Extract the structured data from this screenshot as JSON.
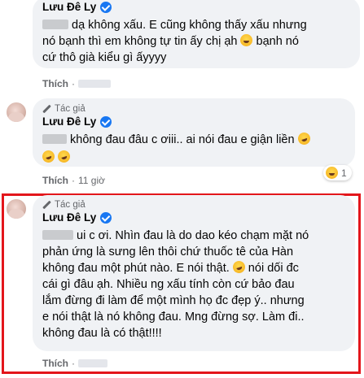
{
  "comments": [
    {
      "author": "Lưu Đê Ly",
      "lines": [
        [
          "",
          " dạ không xấu. E cũng không thấy xấu nhưng"
        ],
        [
          "nó bạnh thì em không tự tin ấy chị ạh ",
          "",
          " bạnh nó"
        ],
        [
          "cứ thô già kiểu gì ấyyyy"
        ]
      ],
      "like_label": "Thích",
      "time": ""
    },
    {
      "author": "Lưu Đê Ly",
      "author_badge": "Tác giả",
      "lines": [
        [
          "",
          " không đau đâu c ơiii.. ai nói đau e giận liền "
        ],
        [
          ""
        ]
      ],
      "like_label": "Thích",
      "time": "11 giờ",
      "reaction_count": "1"
    },
    {
      "author": "Lưu Đê Ly",
      "author_badge": "Tác giả",
      "lines": [
        [
          "",
          " ui c ơi. Nhìn đau là do dao kéo chạm mặt nó"
        ],
        [
          "phản ứng là sưng lên thôi chứ thuốc tê của Hàn"
        ],
        [
          "không đau một phút nào. E nói thật. ",
          "",
          " nói dối đc"
        ],
        [
          "cái gì đâu ạh. Nhiều ng xấu tính còn cứ bảo đau"
        ],
        [
          "lắm đừng đi làm để một mình họ đc đẹp ý.. nhưng"
        ],
        [
          "e nói thật là nó không đau. Mng đừng sợ. Làm đi.."
        ],
        [
          "không đau là có thật!!!!"
        ]
      ],
      "like_label": "Thích",
      "time": ""
    }
  ],
  "separator": "·"
}
